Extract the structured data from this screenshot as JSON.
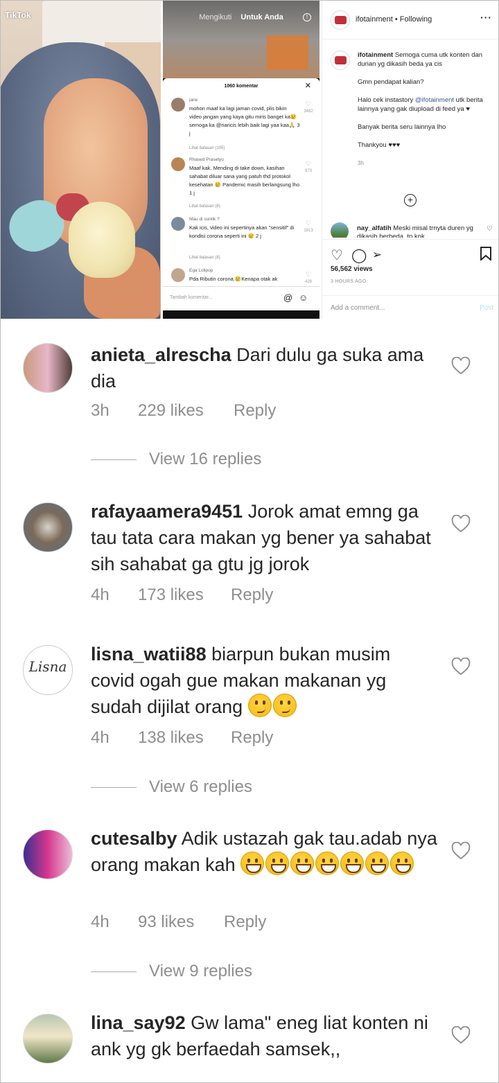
{
  "top_panel": {
    "tiktok_logo": "TikTok",
    "phone": {
      "tab_following": "Mengikuti",
      "tab_for_you": "Untuk Anda",
      "sheet_title": "1060 komentar",
      "comments": [
        {
          "name": "jane",
          "text": "mohon maaf ka lagi jaman covid, plis bikin video jangan yang kaya gitu miris banget ka😢 semoga ka @riaricis lebih baik lagi yaa kaa🙏 3 j",
          "replies": "Lihat balasan (105)",
          "likes": "3482"
        },
        {
          "name": "Rhased Prasetyo",
          "text": "Maaf kak. Mending di take down, kasihan sahabat diluar sana yang patuh thd protokol kesehatan 😢 Pandemic masih berlangsung lho 1 j",
          "replies": "Lihat balasan (8)",
          "likes": "973"
        },
        {
          "name": "Mau di suntik ?",
          "text": "Kak icis, video ini sepertinya akan \"sensitif\" di kondisi corona seperti ini 😢 2 j",
          "replies": "Lihat balasan (8)",
          "likes": "1813"
        },
        {
          "name": "Ega Lolipop",
          "text": "Pda Ributin corona.😢Kenapa otak ak",
          "replies": "",
          "likes": "429"
        }
      ],
      "input_placeholder": "Tambah komentar..."
    },
    "instagram": {
      "username": "ifotainment",
      "following": "• Following",
      "caption_user": "ifotainment",
      "caption_line1": "Semoga cuma utk konten dan durian yg dikasih beda ya cis",
      "caption_line2": "Gmn pendapat kalian?",
      "caption_line3_pre": "Halo cek instastory",
      "caption_mention": "@ifotainment",
      "caption_line3_post": "utk berita lainnya yang gak diupload di feed ya ♥",
      "caption_line4": "Banyak berita seru lainnya lho",
      "caption_line5": "Thankyou ♥♥♥",
      "caption_time": "3h",
      "comment_user": "nay_alfatih",
      "comment_text": "Meski misal trnyta duren yg dikasih berbeda, tp kok",
      "views": "56,562 views",
      "posted": "3 HOURS AGO",
      "add_comment": "Add a comment...",
      "post_button": "Post"
    }
  },
  "comments": [
    {
      "user": "anieta_alrescha",
      "text": "Dari dulu ga suka ama dia",
      "time": "3h",
      "likes": "229 likes",
      "reply": "Reply",
      "view_replies": "View 16 replies"
    },
    {
      "user": "rafayaamera9451",
      "text": "Jorok amat emng ga tau tata cara makan yg bener ya sahabat sih sahabat ga gtu jg jorok",
      "time": "4h",
      "likes": "173 likes",
      "reply": "Reply",
      "view_replies": ""
    },
    {
      "user": "lisna_watii88",
      "text": "biarpun bukan musim covid ogah gue makan makanan yg sudah dijilat orang",
      "time": "4h",
      "likes": "138 likes",
      "reply": "Reply",
      "view_replies": "View 6 replies",
      "avatar_text": "Lisna"
    },
    {
      "user": "cutesalby",
      "text": "Adik ustazah gak tau.adab nya orang makan kah",
      "time": "4h",
      "likes": "93 likes",
      "reply": "Reply",
      "view_replies": "View 9 replies"
    },
    {
      "user": "lina_say92",
      "text": "Gw lama\" eneg liat konten ni ank yg gk berfaedah samsek,,",
      "time": "",
      "likes": "",
      "reply": "",
      "view_replies": ""
    }
  ]
}
